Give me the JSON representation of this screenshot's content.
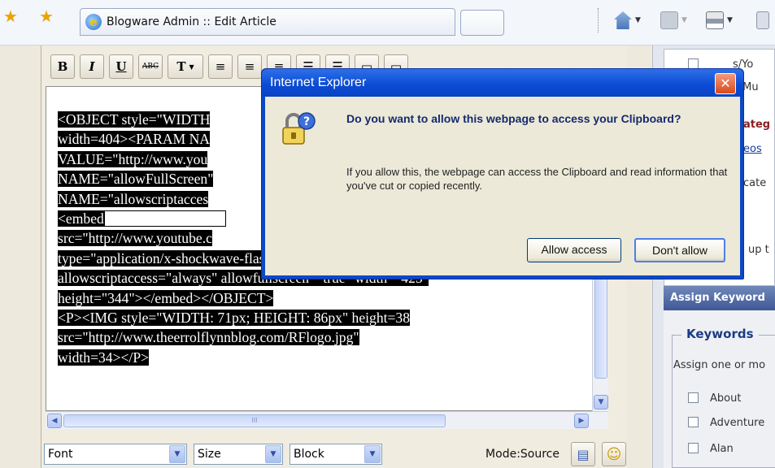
{
  "browser": {
    "tab_title": "Blogware Admin :: Edit Article"
  },
  "editor": {
    "format_buttons": [
      "B",
      "I",
      "U",
      "ABC",
      "T"
    ],
    "source_lines": [
      "<OBJECT style=\"WIDTH",
      "width=404><PARAM NA",
      "VALUE=\"http://www.you",
      "NAME=\"allowFullScreen\"",
      "NAME=\"allowscriptacces",
      "<embed",
      "src=\"http://www.youtube.c",
      "type=\"application/x-shockwave-flash\"",
      "allowscriptaccess=\"always\" allowfullscreen=\"true\" width=\"425\"",
      "height=\"344\"></embed></OBJECT>",
      "<P><IMG style=\"WIDTH: 71px; HEIGHT: 86px\" height=38",
      "src=\"http://www.theerrolflynnblog.com/RFlogo.jpg\"",
      "width=34></P>"
    ],
    "font_select": "Font",
    "size_select": "Size",
    "block_select": "Block",
    "mode_label": "Mode:Source"
  },
  "sidebar": {
    "partial_items": [
      "s/Yo",
      "s/Mu"
    ],
    "categories_partial": "ateg",
    "videos_partial": "eos",
    "cate_partial": "cate",
    "up_partial": "up t",
    "assign_keywords_header": "Assign Keyword",
    "keywords_legend": "Keywords",
    "assign_text": "Assign one or mo",
    "keywords": [
      "About",
      "Adventure",
      "Alan"
    ]
  },
  "dialog": {
    "title": "Internet Explorer",
    "question": "Do you want to allow this webpage to access your Clipboard?",
    "description": "If you allow this, the webpage can access the Clipboard and read information that you've cut or copied recently.",
    "allow_label": "Allow access",
    "deny_label": "Don't allow"
  },
  "colors": {
    "dialog_title_bar": "#0a4ad3",
    "selection": "#000000",
    "keywords_header": "#4b63a0"
  }
}
